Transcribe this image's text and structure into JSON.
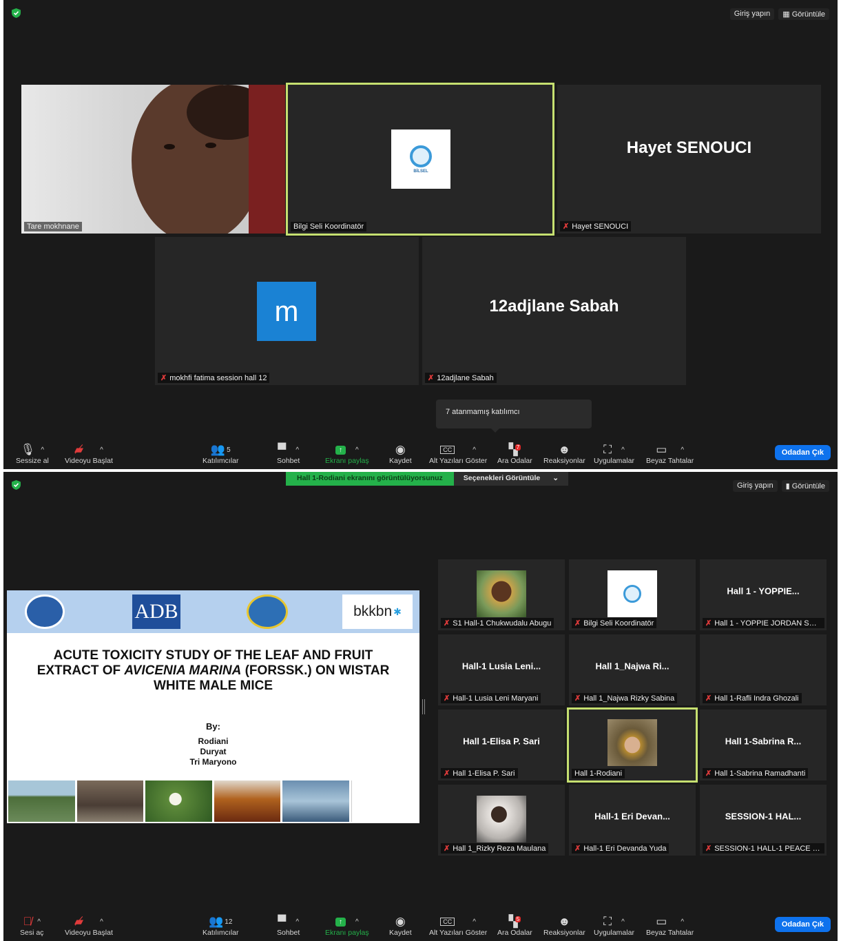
{
  "top": {
    "signin": "Giriş yapın",
    "view": "Görüntüle",
    "tiles": [
      {
        "name": "Tare mokhnane"
      },
      {
        "name": "Bilgi Seli Koordinatör",
        "logo": "BİLSEL"
      },
      {
        "name": "Hayet SENOUCI",
        "big": "Hayet SENOUCI"
      },
      {
        "name": "mokhfi fatima  session hall 12",
        "letter": "m"
      },
      {
        "name": "12adjlane Sabah",
        "big": "12adjlane Sabah"
      }
    ],
    "tooltip": "7 atanmamış katılımcı",
    "toolbar": {
      "mute": "Sessize al",
      "video": "Videoyu Başlat",
      "participants": "Katılımcılar",
      "participants_count": "5",
      "chat": "Sohbet",
      "share": "Ekranı paylaş",
      "record": "Kaydet",
      "captions": "Alt Yazıları Göster",
      "breakout": "Ara Odalar",
      "breakout_count": "7",
      "reactions": "Reaksiyonlar",
      "apps": "Uygulamalar",
      "whiteboard": "Beyaz Tahtalar",
      "leave": "Odadan Çık"
    }
  },
  "bottom": {
    "banner": "Hall 1-Rodiani ekranını görüntülüyorsunuz",
    "options": "Seçenekleri Görüntüle",
    "signin": "Giriş yapın",
    "view": "Görüntüle",
    "slide": {
      "logo_adb": "ADB",
      "logo_bkkbn": "bkkbn",
      "title_1": "ACUTE TOXICITY STUDY OF THE LEAF AND FRUIT",
      "title_2a": "EXTRACT OF ",
      "title_2b": "AVICENIA MARINA",
      "title_2c": " (FORSSK.) ON WISTAR",
      "title_3": "WHITE MALE MICE",
      "by": "By:",
      "authors": [
        "Rodiani",
        "Duryat",
        "Tri Maryono"
      ]
    },
    "tiles": [
      {
        "name": "S1 Hall-1 Chukwudalu Abugu"
      },
      {
        "name": "Bilgi Seli Koordinatör"
      },
      {
        "name": "Hall 1 - YOPPIE JORDAN SAR...",
        "big": "Hall 1 - YOPPIE..."
      },
      {
        "name": "Hall-1 Lusia Leni Maryani",
        "big": "Hall-1 Lusia Leni..."
      },
      {
        "name": "Hall 1_Najwa Rizky Sabina",
        "big": "Hall 1_Najwa Ri..."
      },
      {
        "name": "Hall 1-Rafli Indra Ghozali"
      },
      {
        "name": "Hall 1-Elisa P. Sari",
        "big": "Hall 1-Elisa P. Sari"
      },
      {
        "name": "Hall 1-Rodiani"
      },
      {
        "name": "Hall 1-Sabrina Ramadhanti",
        "big": "Hall 1-Sabrina R..."
      },
      {
        "name": "Hall 1_Rizky Reza Maulana"
      },
      {
        "name": "Hall-1 Eri Devanda Yuda",
        "big": "Hall-1 Eri Devan..."
      },
      {
        "name": "SESSION-1 HALL-1 PEACE OR...",
        "big": "SESSION-1 HAL..."
      }
    ],
    "toolbar": {
      "mute": "Sesi aç",
      "video": "Videoyu Başlat",
      "participants": "Katılımcılar",
      "participants_count": "12",
      "chat": "Sohbet",
      "share": "Ekranı paylaş",
      "record": "Kaydet",
      "captions": "Alt Yazıları Göster",
      "breakout": "Ara Odalar",
      "breakout_count": "5",
      "reactions": "Reaksiyonlar",
      "apps": "Uygulamalar",
      "whiteboard": "Beyaz Tahtalar",
      "leave": "Odadan Çık"
    }
  }
}
